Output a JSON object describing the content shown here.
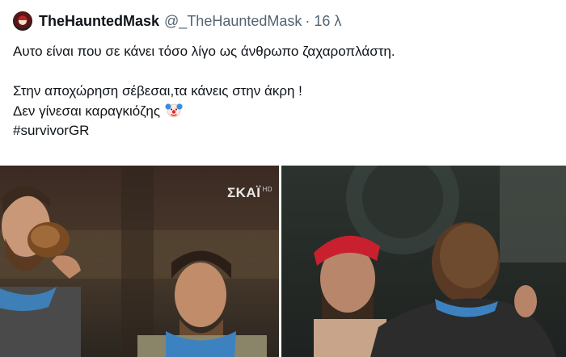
{
  "tweet": {
    "author_name": "TheHauntedMask",
    "handle": "@_TheHauntedMask",
    "separator": "·",
    "time": "16 λ",
    "text_lines": [
      "Αυτο είναι που σε κάνει τόσο λίγο ως άνθρωπο ζαχαροπλάστη.",
      "",
      "Στην αποχώρηση σέβεσαι,τα κάνεις στην άκρη !",
      "Δεν γίνεσαι καραγκιόζης",
      "#survivorGR"
    ],
    "emoji_icon": "clown-face-icon"
  },
  "media": {
    "left_photo": {
      "channel_logo": "ΣΚΑΪ",
      "logo_suffix": "HD"
    },
    "right_photo": {}
  },
  "colors": {
    "text": "#0f1419",
    "secondary_text": "#536471",
    "background": "#ffffff"
  }
}
